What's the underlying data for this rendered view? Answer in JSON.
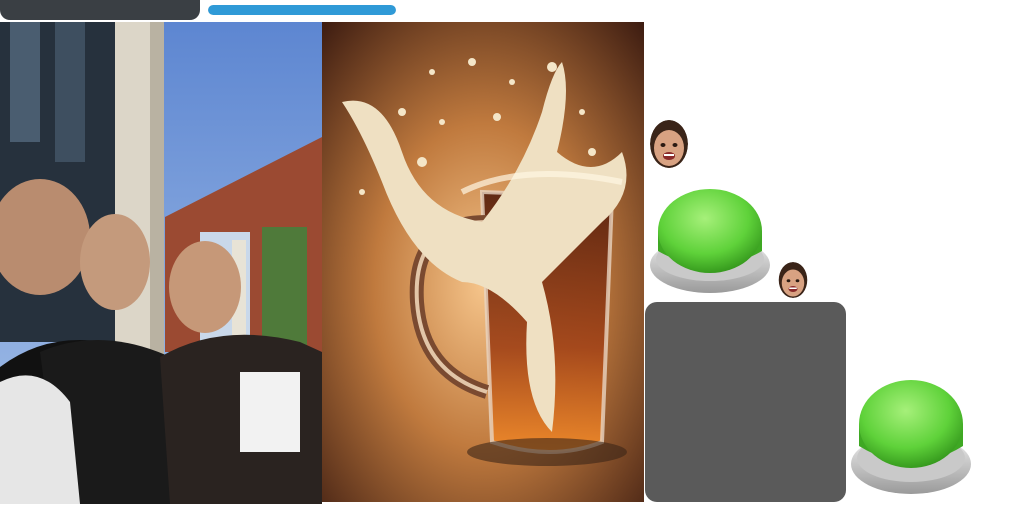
{
  "hud": {
    "progress_fraction": 1.0,
    "progress_color": "#2f9ad7",
    "panel_color": "#3a3f44"
  },
  "scene": {
    "photo": {
      "icon": "group-selfie-photo"
    },
    "beer": {
      "icon": "beer-mug-splash"
    },
    "avatars": [
      {
        "icon": "player-face-avatar"
      },
      {
        "icon": "player-face-avatar"
      }
    ],
    "buttons": [
      {
        "icon": "green-arcade-button",
        "color": "#5fd23a"
      },
      {
        "icon": "green-arcade-button",
        "color": "#5fd23a"
      }
    ],
    "block_color": "#5a5a5a"
  }
}
